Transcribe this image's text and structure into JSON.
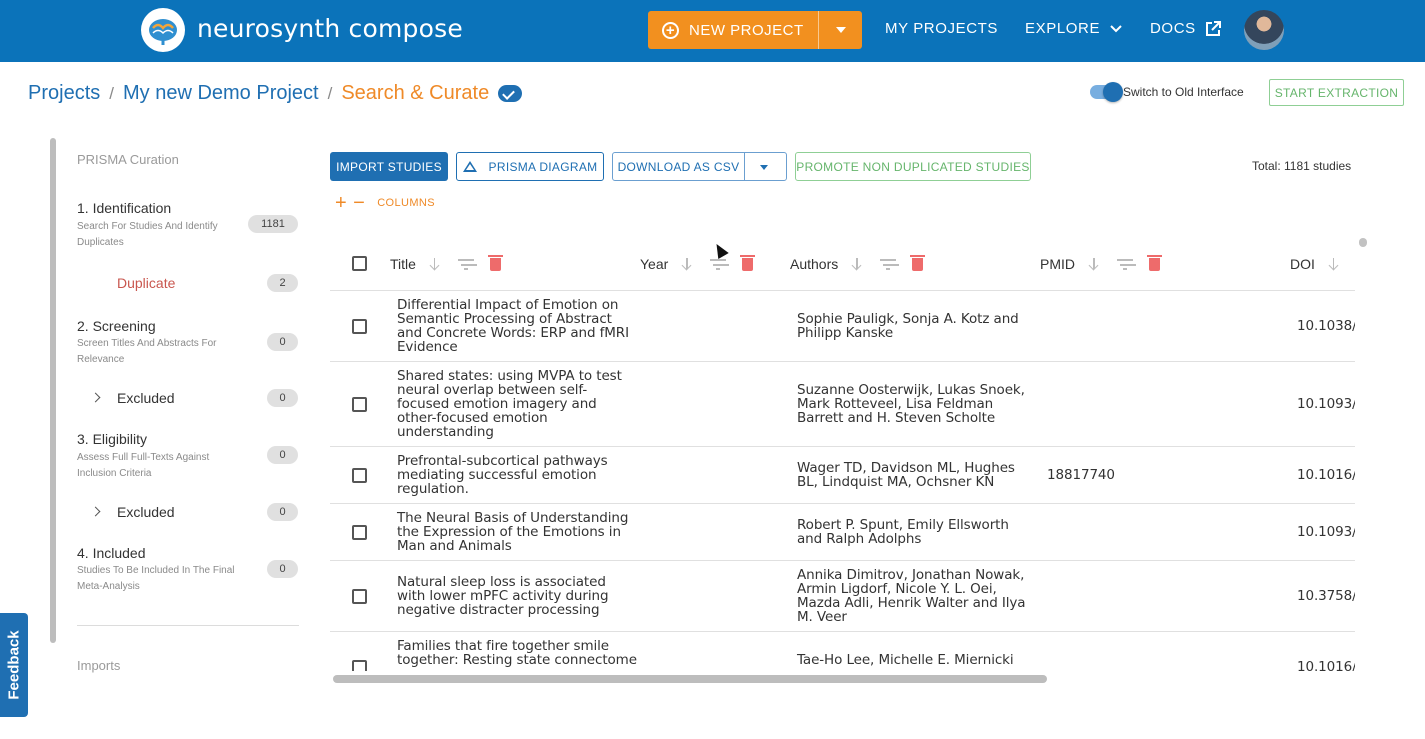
{
  "header": {
    "brand": "neurosynth compose",
    "new_project_label": "NEW PROJECT",
    "nav": {
      "my_projects": "MY PROJECTS",
      "explore": "EXPLORE",
      "docs": "DOCS"
    }
  },
  "breadcrumb": {
    "projects": "Projects",
    "project_name": "My new Demo Project",
    "current": "Search & Curate",
    "sep": "/"
  },
  "toggle": {
    "label": "Switch to Old Interface"
  },
  "start_extraction_label": "START EXTRACTION",
  "sidebar": {
    "title": "PRISMA Curation",
    "identification": {
      "title": "1. Identification",
      "desc": "Search For Studies And Identify Duplicates",
      "count": "1181"
    },
    "duplicate": {
      "label": "Duplicate",
      "count": "2"
    },
    "screening": {
      "title": "2. Screening",
      "desc": "Screen Titles And Abstracts For Relevance",
      "count": "0"
    },
    "screening_excluded": {
      "label": "Excluded",
      "count": "0"
    },
    "eligibility": {
      "title": "3. Eligibility",
      "desc": "Assess Full Full-Texts Against Inclusion Criteria",
      "count": "0"
    },
    "eligibility_excluded": {
      "label": "Excluded",
      "count": "0"
    },
    "included": {
      "title": "4. Included",
      "desc": "Studies To Be Included In The Final Meta-Analysis",
      "count": "0"
    },
    "imports": "Imports"
  },
  "feedback_label": "Feedback",
  "toolbar": {
    "import": "IMPORT STUDIES",
    "prisma": "PRISMA DIAGRAM",
    "download": "DOWNLOAD AS CSV",
    "promote": "PROMOTE NON DUPLICATED STUDIES",
    "total": "Total: 1181 studies",
    "columns": "COLUMNS"
  },
  "table": {
    "columns": {
      "title": "Title",
      "year": "Year",
      "authors": "Authors",
      "pmid": "PMID",
      "doi": "DOI"
    },
    "rows": [
      {
        "title": [
          "Differential Impact of Emotion on",
          "Semantic Processing of Abstract",
          "and Concrete Words: ERP and fMRI",
          "Evidence"
        ],
        "authors": [
          "Sophie Pauligk, Sonja A. Kotz and",
          "Philipp Kanske"
        ],
        "pmid": "",
        "doi": "10.1038/"
      },
      {
        "title": [
          "Shared states: using MVPA to test",
          "neural overlap between self-",
          "focused emotion imagery and",
          "other-focused emotion",
          "understanding"
        ],
        "authors": [
          "Suzanne Oosterwijk, Lukas Snoek,",
          "Mark Rotteveel, Lisa Feldman",
          "Barrett and H. Steven Scholte"
        ],
        "pmid": "",
        "doi": "10.1093/"
      },
      {
        "title": [
          "Prefrontal-subcortical pathways",
          "mediating successful emotion",
          "regulation."
        ],
        "authors": [
          "Wager TD, Davidson ML, Hughes",
          "BL, Lindquist MA, Ochsner KN"
        ],
        "pmid": "18817740",
        "doi": "10.1016/"
      },
      {
        "title": [
          "The Neural Basis of Understanding",
          "the Expression of the Emotions in",
          "Man and Animals"
        ],
        "authors": [
          "Robert P. Spunt, Emily Ellsworth",
          "and Ralph Adolphs"
        ],
        "pmid": "",
        "doi": "10.1093/"
      },
      {
        "title": [
          "Natural sleep loss is associated",
          "with lower mPFC activity during",
          "negative distracter processing"
        ],
        "authors": [
          "Annika Dimitrov, Jonathan Nowak,",
          "Armin Ligdorf, Nicole Y. L. Oei,",
          "Mazda Adli, Henrik Walter and Ilya",
          "M. Veer"
        ],
        "pmid": "",
        "doi": "10.3758/"
      },
      {
        "title": [
          "Families that fire together smile",
          "together: Resting state connectome"
        ],
        "authors": [
          "Tae-Ho Lee, Michelle E. Miernicki"
        ],
        "pmid": "",
        "doi": "10.1016/"
      }
    ]
  }
}
